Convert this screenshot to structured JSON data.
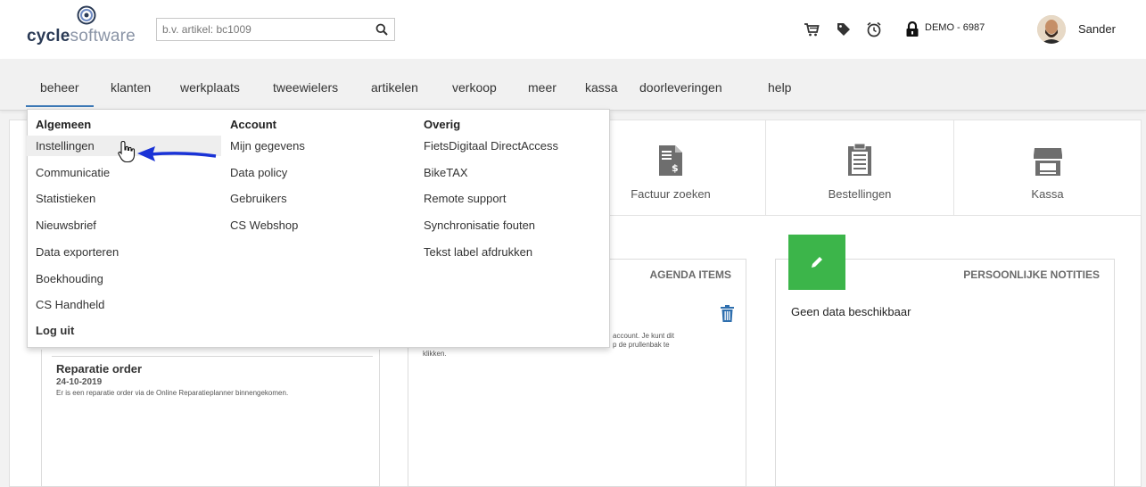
{
  "header": {
    "logo": {
      "bold": "cycle",
      "light": "software"
    },
    "search": {
      "placeholder": "b.v. artikel: bc1009"
    },
    "icons": [
      "cart-icon",
      "tag-icon",
      "alarm-clock-icon",
      "lock-icon"
    ],
    "account_label": "DEMO - 6987",
    "username": "Sander"
  },
  "nav": {
    "items": [
      {
        "label": "beheer"
      },
      {
        "label": "klanten"
      },
      {
        "label": "werkplaats"
      },
      {
        "label": "tweewielers"
      },
      {
        "label": "artikelen"
      },
      {
        "label": "verkoop"
      },
      {
        "label": "meer"
      },
      {
        "label": "kassa"
      },
      {
        "label": "doorleveringen"
      },
      {
        "label": "help"
      }
    ]
  },
  "dropdown": {
    "columns": [
      {
        "heading": "Algemeen",
        "items": [
          "Instellingen",
          "Communicatie",
          "Statistieken",
          "Nieuwsbrief",
          "Data exporteren",
          "Boekhouding",
          "CS Handheld",
          "Log uit"
        ]
      },
      {
        "heading": "Account",
        "items": [
          "Mijn gegevens",
          "Data policy",
          "Gebruikers",
          "CS Webshop"
        ]
      },
      {
        "heading": "Overig",
        "items": [
          "FietsDigitaal DirectAccess",
          "BikeTAX",
          "Remote support",
          "Synchronisatie fouten",
          "Tekst label afdrukken"
        ]
      }
    ]
  },
  "tiles": [
    {
      "label": "Factuur zoeken",
      "icon": "invoice-search-icon"
    },
    {
      "label": "Bestellingen",
      "icon": "clipboard-icon"
    },
    {
      "label": "Kassa",
      "icon": "shop-icon"
    }
  ],
  "panels": {
    "agenda": {
      "title": "AGENDA ITEMS",
      "text_line1": "account. Je kunt dit",
      "text_line2": "p de prullenbak te",
      "text_line3": "klikken."
    },
    "notes": {
      "title": "PERSOONLIJKE NOTITIES",
      "empty": "Geen data beschikbaar"
    },
    "messages": {
      "title": "Reparatie order",
      "date": "24-10-2019",
      "body": "Er is een reparatie order via de Online Reparatieplanner binnengekomen."
    }
  },
  "colors": {
    "active_underline": "#3c79b6",
    "green_button": "#3cb54a",
    "arrow": "#1a33d6",
    "trash": "#2f6fae"
  }
}
